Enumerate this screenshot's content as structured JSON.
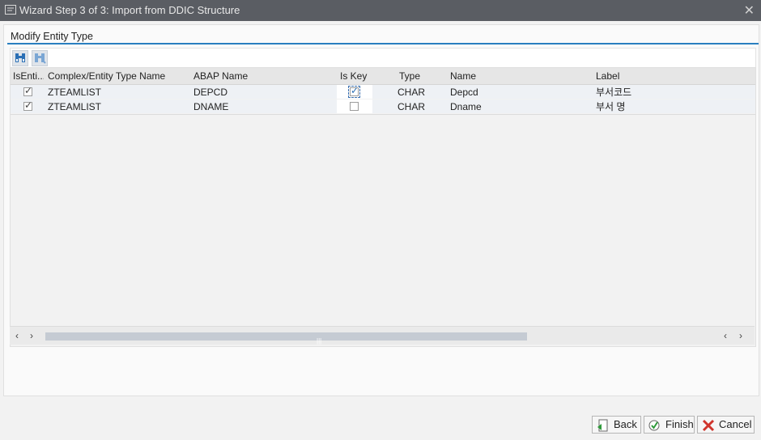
{
  "window": {
    "title": "Wizard Step 3 of 3: Import from DDIC Structure",
    "close_glyph": "✕"
  },
  "section": {
    "title": "Modify Entity Type"
  },
  "toolbar": {
    "icons": [
      "binoculars-icon",
      "find-next-icon"
    ]
  },
  "table": {
    "columns": [
      "IsEnti...",
      "Complex/Entity Type Name",
      "ABAP Name",
      "Is Key",
      "Type",
      "Name",
      "Label"
    ],
    "rows": [
      {
        "is_entity": true,
        "complex_name": "ZTEAMLIST",
        "abap_name": "DEPCD",
        "is_key": true,
        "type": "CHAR",
        "name": "Depcd",
        "label": "부서코드"
      },
      {
        "is_entity": true,
        "complex_name": "ZTEAMLIST",
        "abap_name": "DNAME",
        "is_key": false,
        "type": "CHAR",
        "name": "Dname",
        "label": "부서 명"
      }
    ]
  },
  "scrollbar": {
    "left_glyph": "‹",
    "right_glyph": "›",
    "grip": "|||"
  },
  "buttons": {
    "back": "Back",
    "finish": "Finish",
    "cancel": "Cancel"
  },
  "colors": {
    "titlebar": "#5a5d63",
    "accent": "#2a7fc0",
    "cancel_red": "#d0342c"
  }
}
